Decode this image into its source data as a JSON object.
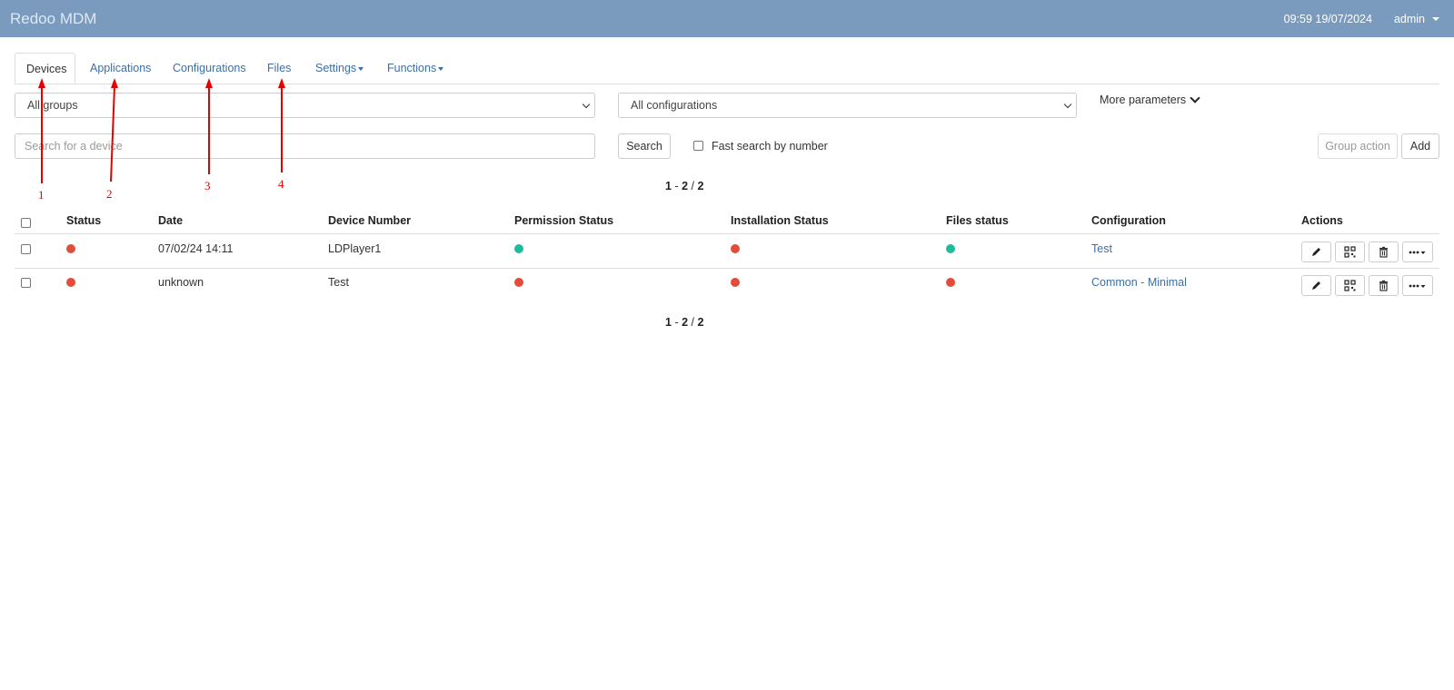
{
  "navbar": {
    "brand": "Redoo MDM",
    "datetime": "09:59 19/07/2024",
    "user": "admin"
  },
  "tabs": [
    {
      "label": "Devices"
    },
    {
      "label": "Applications"
    },
    {
      "label": "Configurations"
    },
    {
      "label": "Files"
    },
    {
      "label": "Settings"
    },
    {
      "label": "Functions"
    }
  ],
  "filters": {
    "group_select": "All groups",
    "config_select": "All configurations",
    "more_parameters": "More parameters",
    "search_placeholder": "Search for a device",
    "search_button": "Search",
    "fast_search_label": "Fast search by number",
    "group_action_button": "Group action",
    "add_button": "Add"
  },
  "pagination": {
    "from": "1",
    "to": "2",
    "total": "2",
    "dash": "-",
    "slash": "/"
  },
  "table": {
    "headers": [
      "Status",
      "Date",
      "Device Number",
      "Permission Status",
      "Installation Status",
      "Files status",
      "Configuration",
      "Actions"
    ],
    "rows": [
      {
        "date": "07/02/24 14:11",
        "device_number": "LDPlayer1",
        "configuration": "Test",
        "status": "red",
        "permission": "green",
        "installation": "red",
        "files": "green"
      },
      {
        "date": "unknown",
        "device_number": "Test",
        "configuration": "Common - Minimal",
        "status": "red",
        "permission": "red",
        "installation": "red",
        "files": "red"
      }
    ]
  },
  "colors": {
    "red": "#e24c3b",
    "green": "#1fbc9c",
    "navbar": "#7a9bbd",
    "link": "#3d6ea3",
    "annotation": "#e60000"
  },
  "annotations": [
    "1",
    "2",
    "3",
    "4"
  ]
}
